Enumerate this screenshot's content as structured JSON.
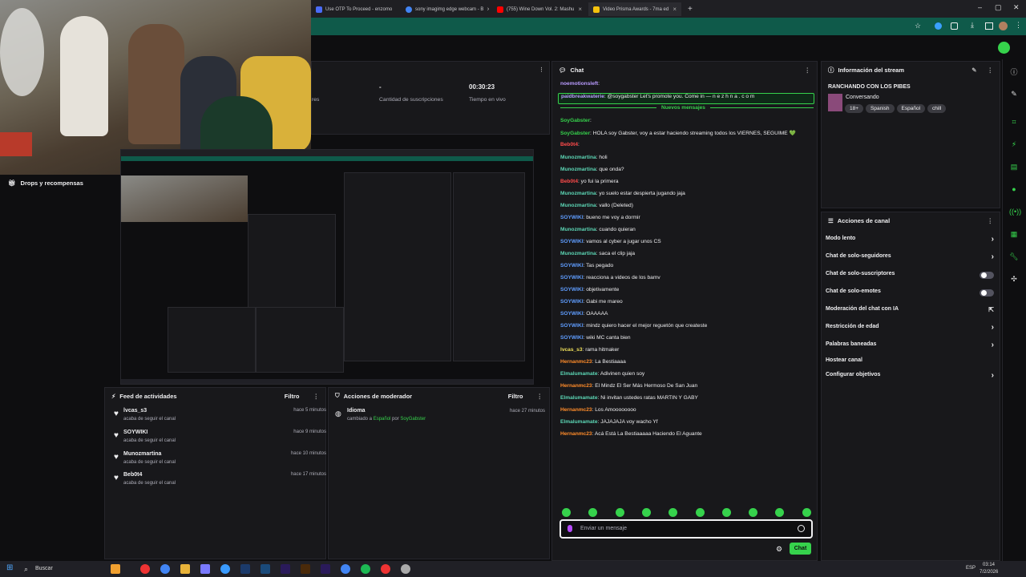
{
  "browser": {
    "tabs": [
      {
        "label": "Use OTP To Proceed - enzomo",
        "color": "#4a6cf7"
      },
      {
        "label": "sony imagimg edge webcam - B",
        "color": "#4285f4"
      },
      {
        "label": "(755) Wine Down Vol. 2: Mashu",
        "color": "#ff0000"
      },
      {
        "label": "Video Prisma Awards - 7ma ed",
        "color": "#f4c20d"
      }
    ],
    "new_tab": "+",
    "window_controls": [
      "–",
      "▢",
      "✕"
    ]
  },
  "stats": {
    "col1_value": "-",
    "col1_label": "Cantidad de suscripciones",
    "col2_value": "00:30:23",
    "col2_label": "Tiempo en vivo",
    "cut_label": "res"
  },
  "drops": {
    "title": "Drops y recompensas"
  },
  "activity_feed": {
    "title": "Feed de actividades",
    "filter": "Filtro",
    "items": [
      {
        "name": "lvcas_s3",
        "sub": "acaba de seguir el canal",
        "time": "hace 5 minutos"
      },
      {
        "name": "SOYWIKI",
        "sub": "acaba de seguir el canal",
        "time": "hace 9 minutos"
      },
      {
        "name": "Munozmartina",
        "sub": "acaba de seguir el canal",
        "time": "hace 10 minutos"
      },
      {
        "name": "Beb0t4",
        "sub": "acaba de seguir el canal",
        "time": "hace 17 minutos"
      }
    ]
  },
  "mod_actions": {
    "title": "Acciones de moderador",
    "filter": "Filtro",
    "item": {
      "title": "Idioma",
      "pre": "cambiado a ",
      "lang": "Español",
      "mid": " por ",
      "by": "SoyGabster",
      "time": "hace 27 minutos"
    }
  },
  "chat": {
    "title": "Chat",
    "lines": [
      {
        "user": "noemotionsleft",
        "text": "",
        "color": "#b99bff"
      },
      {
        "user": "paidbreakwaterie",
        "text": "@soygabster Let's promote you. Come in — n e z h n a . c o m",
        "color": "#b99bff",
        "highlight": true
      },
      {
        "user": "SoyGabster",
        "text": "",
        "color": "#36d24c"
      },
      {
        "user": "SoyGabster",
        "text": "HOLA soy Gabster, voy a estar haciendo streaming todos los VIERNES, SEGUIME 💚",
        "color": "#36d24c"
      },
      {
        "user": "Beb0t4",
        "text": "",
        "color": "#ff4b4b"
      },
      {
        "user": "Munozmartina",
        "text": "holi",
        "color": "#5cd6b5"
      },
      {
        "user": "Munozmartina",
        "text": "que onda?",
        "color": "#5cd6b5"
      },
      {
        "user": "Beb0t4",
        "text": "yo fui la primera",
        "color": "#ff4b4b"
      },
      {
        "user": "Munozmartina",
        "text": "yo suelo estar despierta jugando jaja",
        "color": "#5cd6b5"
      },
      {
        "user": "Munozmartina",
        "text": "vallo (Deleted)",
        "color": "#5cd6b5"
      },
      {
        "user": "SOYWIKI",
        "text": "bueno me voy a dormir",
        "color": "#5f9dff"
      },
      {
        "user": "Munozmartina",
        "text": "cuando quieran",
        "color": "#5cd6b5"
      },
      {
        "user": "SOYWIKI",
        "text": "vamos al cyber a jugar unos CS",
        "color": "#5f9dff"
      },
      {
        "user": "Munozmartina",
        "text": "saca el clip jaja",
        "color": "#5cd6b5"
      },
      {
        "user": "SOYWIKI",
        "text": "Tas pegado",
        "color": "#5f9dff"
      },
      {
        "user": "SOYWIKI",
        "text": "reacciona a videos de los bamv",
        "color": "#5f9dff"
      },
      {
        "user": "SOYWIKI",
        "text": "objetivamente",
        "color": "#5f9dff"
      },
      {
        "user": "SOYWIKI",
        "text": "Gabi me mareo",
        "color": "#5f9dff"
      },
      {
        "user": "SOYWIKI",
        "text": "OAAAAA",
        "color": "#5f9dff"
      },
      {
        "user": "SOYWIKI",
        "text": "mindz quiero hacer el mejor reguetón que createste",
        "color": "#5f9dff"
      },
      {
        "user": "SOYWIKI",
        "text": "wiki MC canta bien",
        "color": "#5f9dff"
      },
      {
        "user": "lvcas_s3",
        "text": "rama hitmaker",
        "color": "#f0e05a"
      },
      {
        "user": "Hernanmc23",
        "text": "La Bestiaaaa",
        "color": "#ff8c2a"
      },
      {
        "user": "Elmalumamate",
        "text": "Adivinen quien soy",
        "color": "#5cd6b5"
      },
      {
        "user": "Hernanmc23",
        "text": "El Mindz El Ser Más Hermoso De San Juan",
        "color": "#ff8c2a"
      },
      {
        "user": "Elmalumamate",
        "text": "Ni invitan ustedes ratas MARTIN Y GABY",
        "color": "#5cd6b5"
      },
      {
        "user": "Hernanmc23",
        "text": "Los Amoooooooo",
        "color": "#ff8c2a"
      },
      {
        "user": "Elmalumamate",
        "text": "JAJAJAJA voy wacho Yf",
        "color": "#5cd6b5"
      },
      {
        "user": "Hernanmc23",
        "text": "Acá Está La Bestiaaaaa Haciendo El Aguante",
        "color": "#ff8c2a"
      }
    ],
    "new_messages": "Nuevos mensajes",
    "input_placeholder": "Enviar un mensaje",
    "send_label": "Chat"
  },
  "stream_info": {
    "title": "Información del stream",
    "stream_title": "RANCHANDO CON LOS PIBES",
    "category": "Conversando",
    "tags": [
      "18+",
      "Spanish",
      "Español",
      "chill"
    ]
  },
  "channel_actions": {
    "title": "Acciones de canal",
    "items": [
      {
        "label": "Modo lento",
        "ctrl": "chevron"
      },
      {
        "label": "Chat de solo-seguidores",
        "ctrl": "chevron"
      },
      {
        "label": "Chat de solo-suscriptores",
        "ctrl": "toggle"
      },
      {
        "label": "Chat de solo-emotes",
        "ctrl": "toggle"
      },
      {
        "label": "Moderación del chat con IA",
        "ctrl": "external"
      },
      {
        "label": "Restricción de edad",
        "ctrl": "chevron"
      },
      {
        "label": "Palabras baneadas",
        "ctrl": "chevron"
      },
      {
        "label": "Hostear canal",
        "ctrl": "none"
      },
      {
        "label": "Configurar objetivos",
        "ctrl": "chevron"
      }
    ]
  },
  "taskbar": {
    "search": "Buscar",
    "lang": "ESP",
    "time": "03:14",
    "date": "7/2/2026"
  }
}
